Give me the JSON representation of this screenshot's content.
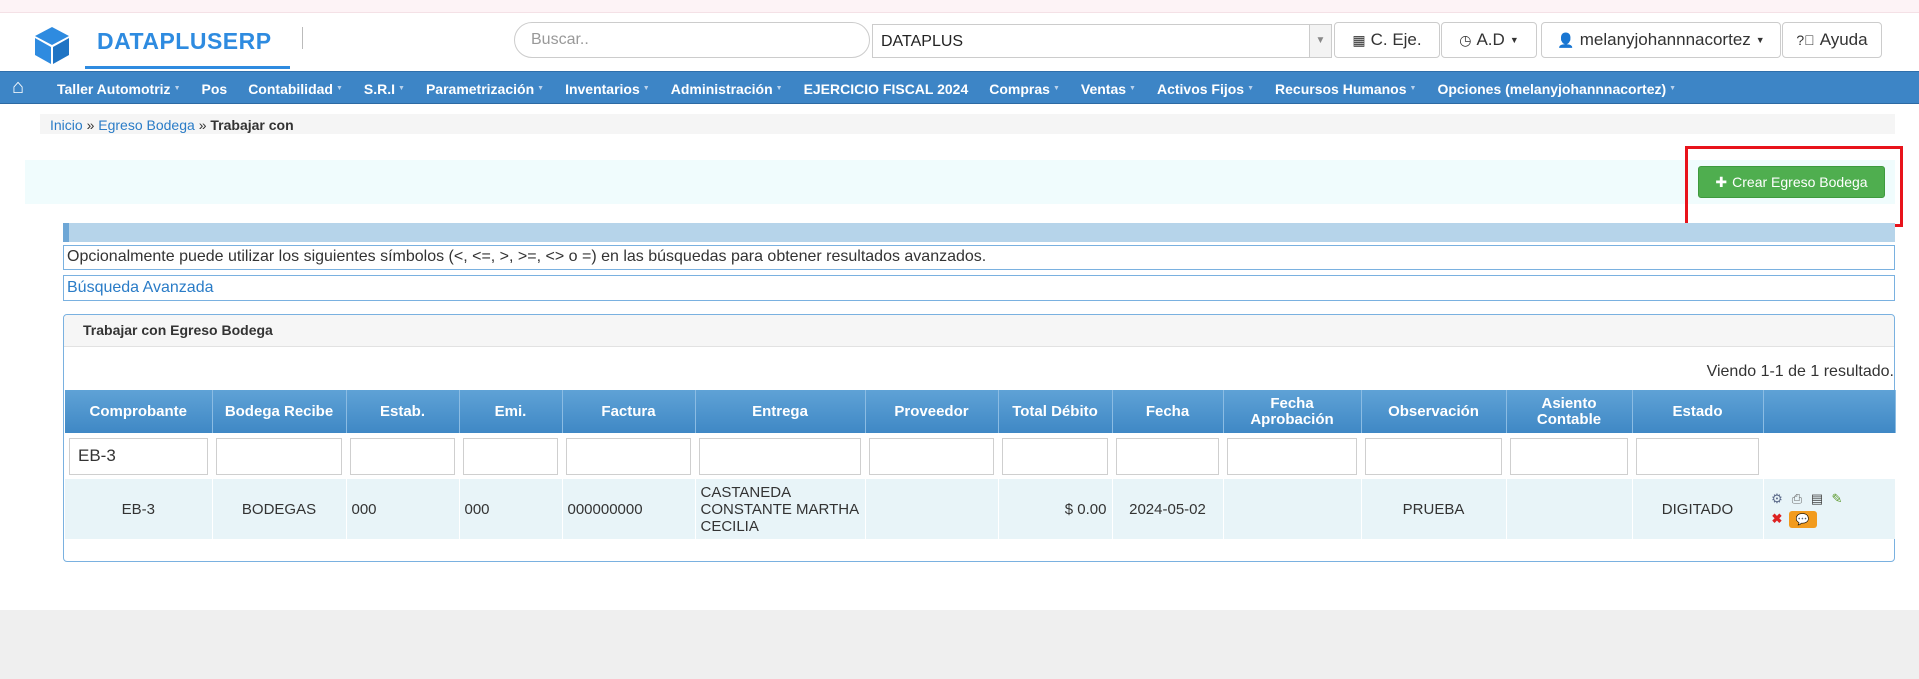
{
  "app": {
    "brand": "DATAPLUSERP"
  },
  "header": {
    "search_placeholder": "Buscar..",
    "company": "DATAPLUS",
    "buttons": {
      "exercise": "C. Eje.",
      "ad": "A.D",
      "user": "melanyjohannnacortez",
      "help": "Ayuda"
    }
  },
  "nav": {
    "items": [
      {
        "label": "Taller Automotriz",
        "dropdown": true
      },
      {
        "label": "Pos",
        "dropdown": false
      },
      {
        "label": "Contabilidad",
        "dropdown": true
      },
      {
        "label": "S.R.I",
        "dropdown": true
      },
      {
        "label": "Parametrización",
        "dropdown": true
      },
      {
        "label": "Inventarios",
        "dropdown": true
      },
      {
        "label": "Administración",
        "dropdown": true
      },
      {
        "label": "EJERCICIO FISCAL 2024",
        "dropdown": false
      },
      {
        "label": "Compras",
        "dropdown": true
      },
      {
        "label": "Ventas",
        "dropdown": true
      },
      {
        "label": "Activos Fijos",
        "dropdown": true
      },
      {
        "label": "Recursos Humanos",
        "dropdown": true
      },
      {
        "label": "Opciones (melanyjohannnacortez)",
        "dropdown": true
      }
    ]
  },
  "breadcrumb": {
    "home": "Inicio",
    "section": "Egreso Bodega",
    "current": "Trabajar con",
    "separator": "»"
  },
  "actions": {
    "create_label": "Crear Egreso Bodega"
  },
  "notice": "Opcionalmente puede utilizar los siguientes símbolos (<, <=, >, >=, <> o =) en las búsquedas para obtener resultados avanzados.",
  "advanced_search": "Búsqueda Avanzada",
  "panel": {
    "title": "Trabajar con Egreso Bodega",
    "result_count": "Viendo 1-1 de 1 resultado.",
    "columns": [
      "Comprobante",
      "Bodega Recibe",
      "Estab.",
      "Emi.",
      "Factura",
      "Entrega",
      "Proveedor",
      "Total Débito",
      "Fecha",
      "Fecha Aprobación",
      "Observación",
      "Asiento Contable",
      "Estado"
    ],
    "filters": [
      "EB-3",
      "",
      "",
      "",
      "",
      "",
      "",
      "",
      "",
      "",
      "",
      "",
      ""
    ],
    "rows": [
      {
        "comprobante": "EB-3",
        "bodega_recibe": "BODEGAS",
        "estab": "000",
        "emi": "000",
        "factura": "000000000",
        "entrega": "CASTANEDA CONSTANTE MARTHA CECILIA",
        "proveedor": "",
        "total_debito": "$ 0.00",
        "fecha": "2024-05-02",
        "fecha_aprobacion": "",
        "observacion": "PRUEBA",
        "asiento_contable": "",
        "estado": "DIGITADO",
        "row_actions": [
          "gear-icon",
          "print-icon",
          "document-icon",
          "edit-icon",
          "delete-icon",
          "comment-icon"
        ]
      }
    ]
  },
  "colors": {
    "brand": "#2e8be0",
    "navbar": "#3d85c6",
    "create_button": "#4fae4f",
    "highlight": "#e8131b",
    "table_header": "#4a90c9",
    "row_background": "#e8f4f8"
  }
}
